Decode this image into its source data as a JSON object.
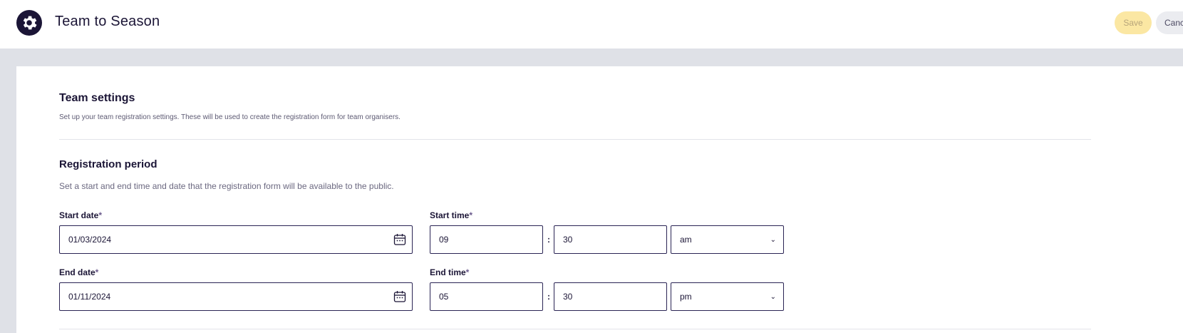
{
  "header": {
    "title": "Team to Season",
    "save_label": "Save",
    "cancel_label": "Cancel"
  },
  "team_settings": {
    "title": "Team settings",
    "description": "Set up your team registration settings. These will be used to create the registration form for team organisers."
  },
  "registration_period": {
    "title": "Registration period",
    "description": "Set a start and end time and date that the registration form will be available to the public.",
    "start_date": {
      "label": "Start date",
      "required_mark": "*",
      "value": "01/03/2024"
    },
    "start_time": {
      "label": "Start time",
      "required_mark": "*",
      "hour": "09",
      "separator": ":",
      "minute": "30",
      "meridiem": "am"
    },
    "end_date": {
      "label": "End date",
      "required_mark": "*",
      "value": "01/11/2024"
    },
    "end_time": {
      "label": "End time",
      "required_mark": "*",
      "hour": "05",
      "separator": ":",
      "minute": "30",
      "meridiem": "pm"
    }
  },
  "icons": {
    "logo": "gear-icon",
    "date_picker": "calendar-icon",
    "select": "chevron-down-icon"
  },
  "colors": {
    "brand_dark": "#1b1536",
    "save_bg": "#fbe7a3",
    "cancel_bg": "#ebecf0",
    "page_bg": "#dfe1e7",
    "input_border": "#2a2454"
  }
}
